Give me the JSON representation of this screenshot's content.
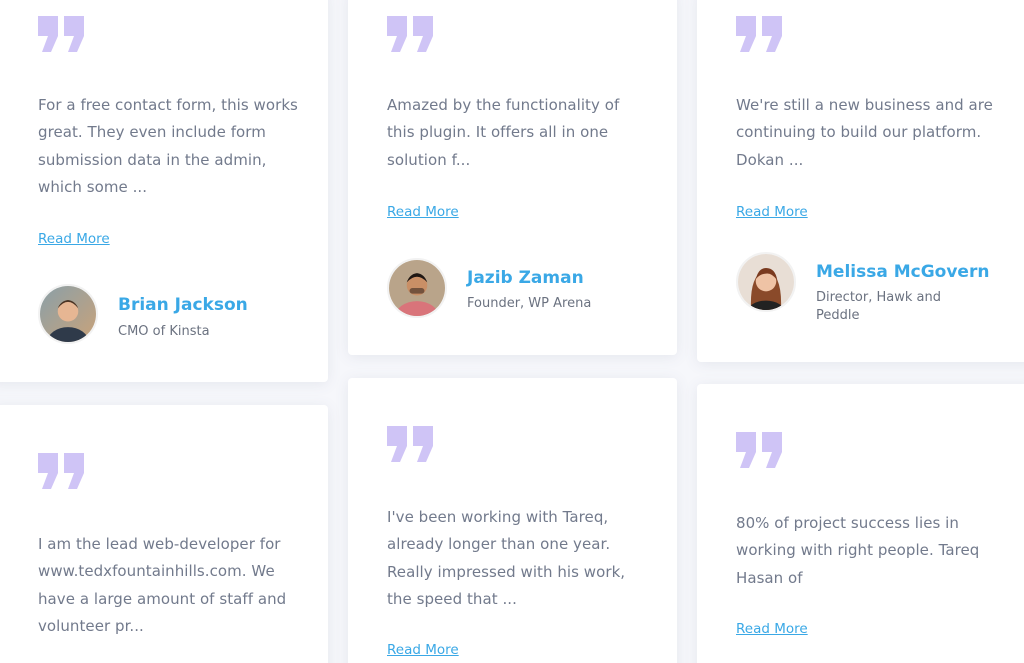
{
  "colors": {
    "background": "#f6f7fb",
    "card": "#ffffff",
    "accent": "#3aa8e6",
    "quote_icon": "#cfc4f6",
    "body_text": "#727a8c"
  },
  "testimonials": [
    {
      "text": "For a free contact form, this works great. They even include form submission data in the admin, which some ...",
      "read_more": "Read More",
      "name": "Brian Jackson",
      "role": "CMO of Kinsta",
      "avatar_icon": "avatar-photo-icon"
    },
    {
      "text": "Amazed by the functionality of this plugin. It offers all in one solution f...",
      "read_more": "Read More",
      "name": "Jazib Zaman",
      "role": "Founder, WP Arena",
      "avatar_icon": "avatar-photo-icon"
    },
    {
      "text": "We're still a new business and are continuing to build our platform. Dokan ...",
      "read_more": "Read More",
      "name": "Melissa McGovern",
      "role": "Director, Hawk and Peddle",
      "avatar_icon": "avatar-photo-icon"
    },
    {
      "text": "I am the lead web-developer for www.tedxfountainhills.com. We have a large amount of staff and volunteer pr..."
    },
    {
      "text": "I've been working with Tareq, already longer than one year. Really impressed with his work, the speed that ...",
      "read_more": "Read More"
    },
    {
      "text": "80% of project success lies in working with right people. Tareq Hasan of",
      "read_more": "Read More"
    }
  ]
}
